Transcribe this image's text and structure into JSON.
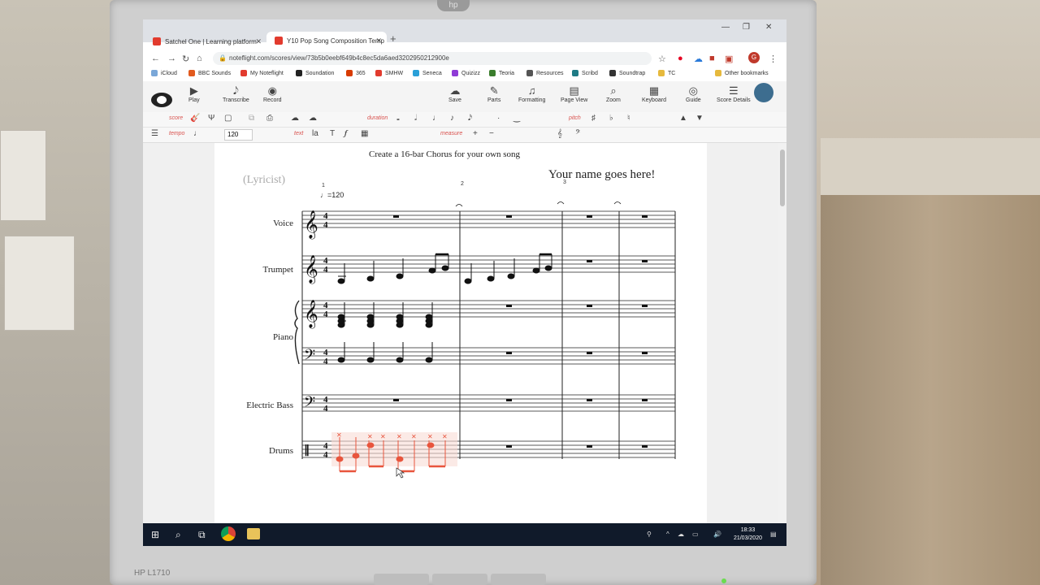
{
  "browser": {
    "tabs": [
      {
        "label": "Satchel One | Learning platform",
        "active": false,
        "favicon_color": "#e23b2e"
      },
      {
        "label": "Y10 Pop Song Composition Temp",
        "active": true,
        "favicon_color": "#e23b2e"
      }
    ],
    "new_tab": "+",
    "url": "noteflight.com/scores/view/73b5b0eebf649b4c8ec5da6aed3202950212900e",
    "bookmarks": [
      {
        "label": "iCloud",
        "color": "#7aa7d8"
      },
      {
        "label": "BBC Sounds",
        "color": "#e25a1e"
      },
      {
        "label": "My Noteflight",
        "color": "#e23b2e"
      },
      {
        "label": "Soundation",
        "color": "#222222"
      },
      {
        "label": "365",
        "color": "#d83b01"
      },
      {
        "label": "SMHW",
        "color": "#e23b2e"
      },
      {
        "label": "Seneca",
        "color": "#2aa0d8"
      },
      {
        "label": "Quizizz",
        "color": "#8f3bd6"
      },
      {
        "label": "Teoria",
        "color": "#3a7d2c"
      },
      {
        "label": "Resources",
        "color": "#555555"
      },
      {
        "label": "Scribd",
        "color": "#1e7b85"
      },
      {
        "label": "Soundtrap",
        "color": "#333333"
      },
      {
        "label": "TC",
        "color": "#e6b93d"
      }
    ],
    "other_bookmarks": "Other bookmarks",
    "profile_initial": "G"
  },
  "toolbar": {
    "play": "Play",
    "transcribe": "Transcribe",
    "record": "Record",
    "save": "Save",
    "parts": "Parts",
    "formatting": "Formatting",
    "page_view": "Page View",
    "zoom": "Zoom",
    "keyboard": "Keyboard",
    "guide": "Guide",
    "score_details": "Score Details"
  },
  "palette": {
    "score": "score",
    "duration": "duration",
    "pitch": "pitch",
    "tempo": "tempo",
    "tempo_value": "120",
    "text": "text",
    "measure": "measure"
  },
  "score": {
    "subtitle": "Create a 16-bar Chorus for your own song",
    "lyricist": "(Lyricist)",
    "composer": "Your name goes here!",
    "tempo_mark": "=120",
    "bar_numbers": [
      "1",
      "2",
      "3"
    ],
    "instruments": [
      "Voice",
      "Trumpet",
      "Piano",
      "Electric Bass",
      "Drums"
    ]
  },
  "taskbar": {
    "time": "18:33",
    "date": "21/03/2020"
  },
  "monitor": {
    "brand": "HP L1710"
  }
}
